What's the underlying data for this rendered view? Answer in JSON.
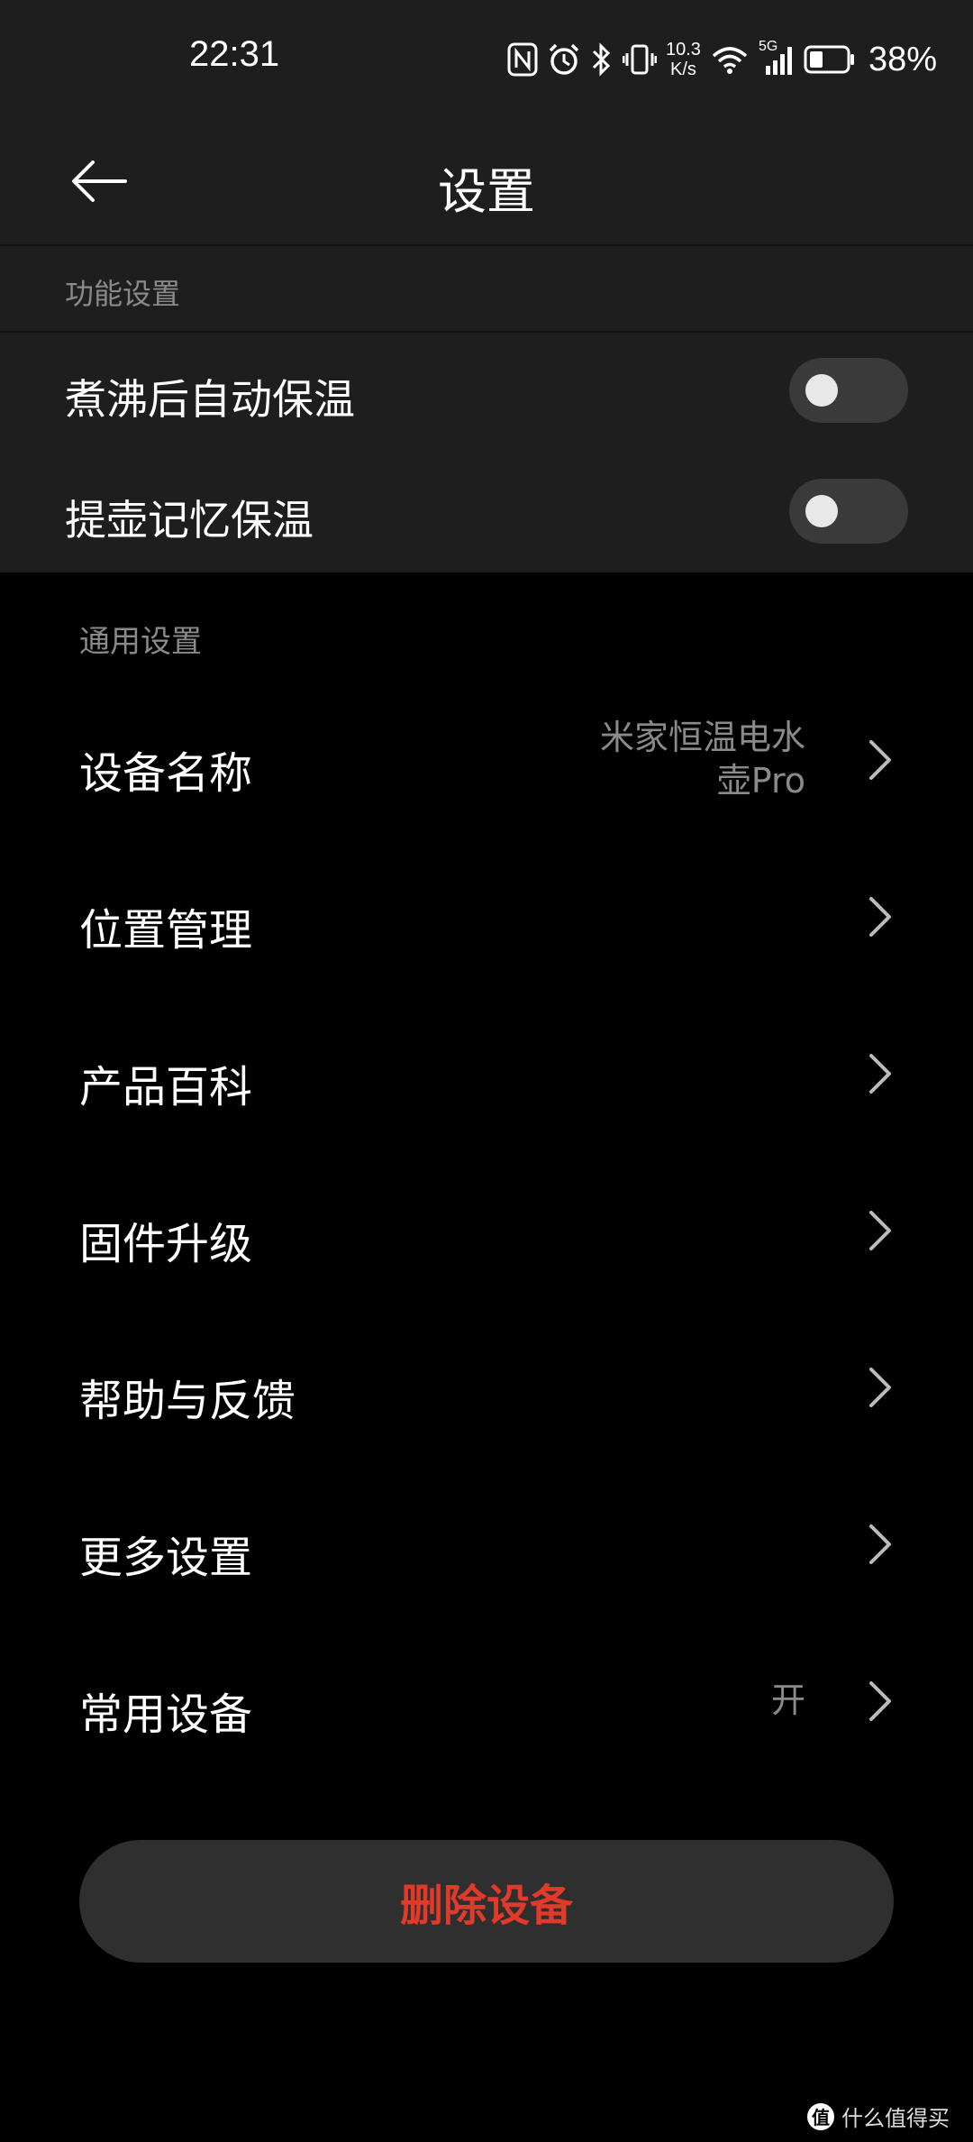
{
  "status_bar": {
    "time": "22:31",
    "net_speed_value": "10.3",
    "net_speed_unit": "K/s",
    "signal_label": "5G",
    "battery_percent": "38%",
    "battery_level": 0.38,
    "icons": [
      "nfc-icon",
      "alarm-icon",
      "bluetooth-icon",
      "vibrate-icon",
      "wifi-icon",
      "cellular-signal-icon",
      "battery-icon"
    ]
  },
  "header": {
    "title": "设置"
  },
  "function_settings": {
    "section_label": "功能设置",
    "toggles": [
      {
        "label": "煮沸后自动保温",
        "on": false
      },
      {
        "label": "提壶记忆保温",
        "on": false
      }
    ]
  },
  "general_settings": {
    "section_label": "通用设置",
    "items": [
      {
        "label": "设备名称",
        "value_line1": "米家恒温电水",
        "value_line2": "壶Pro"
      },
      {
        "label": "位置管理",
        "value": ""
      },
      {
        "label": "产品百科",
        "value": ""
      },
      {
        "label": "固件升级",
        "value": ""
      },
      {
        "label": "帮助与反馈",
        "value": ""
      },
      {
        "label": "更多设置",
        "value": ""
      },
      {
        "label": "常用设备",
        "value": "开"
      }
    ]
  },
  "delete_button": {
    "label": "删除设备"
  },
  "watermark": {
    "logo": "值",
    "text": "什么值得买"
  },
  "colors": {
    "background": "#000000",
    "panel": "#1e1e1e",
    "toggle_off": "#3a3a3a",
    "danger": "#e13a2a",
    "secondary_text": "#8a8a8a"
  }
}
